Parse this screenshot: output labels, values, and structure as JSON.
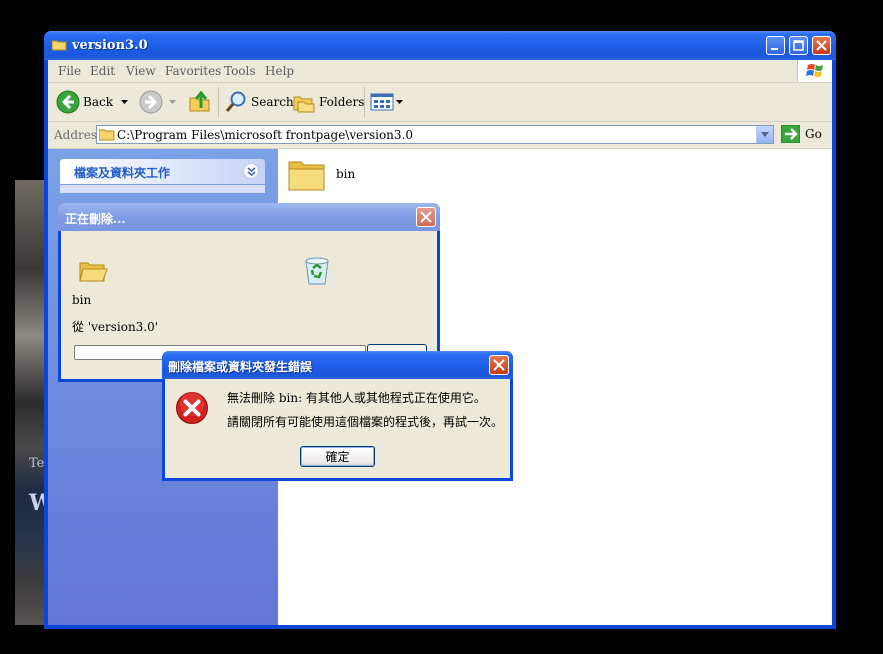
{
  "window": {
    "title": "version3.0"
  },
  "menu": [
    "File",
    "Edit",
    "View",
    "Favorites",
    "Tools",
    "Help"
  ],
  "toolbar": {
    "back_label": "Back",
    "search_label": "Search",
    "folders_label": "Folders"
  },
  "address": {
    "label": "Address",
    "value": "C:\\Program Files\\microsoft frontpage\\version3.0",
    "go_label": "Go"
  },
  "taskpane": {
    "header": "檔案及資料夾工作"
  },
  "files": [
    {
      "name": "bin",
      "icon": "folder-icon"
    }
  ],
  "progress_dialog": {
    "title": "正在刪除...",
    "file_name": "bin",
    "from_text": "從 'version3.0'",
    "progress": 0.0
  },
  "error_dialog": {
    "title": "刪除檔案或資料夾發生錯誤",
    "message_line1": "無法刪除 bin: 有其他人或其他程式正在使用它。",
    "message_line2": "請關閉所有可能使用這個檔案的程式後，再試一次。",
    "ok_label": "確定"
  },
  "backdrop": {
    "text_a": "Te",
    "text_b": "W"
  },
  "colors": {
    "title_blue": "#0a46d8",
    "taskpane_top": "#7ba2e7",
    "taskpane_bottom": "#6375d6",
    "dialog_face": "#ece9d8",
    "error_red": "#d21f1f"
  }
}
